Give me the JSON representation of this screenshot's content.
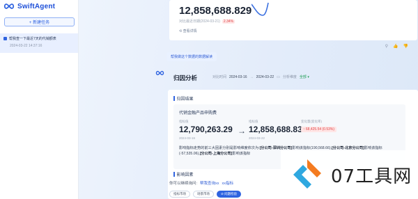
{
  "app": {
    "name": "SwiftAgent"
  },
  "sidebar": {
    "new_task_label": "+ 新建任务",
    "history": [
      {
        "title": "帮我查一下最近7天的代销额表",
        "date": "2024-03-22 14:37:16"
      }
    ]
  },
  "card1": {
    "value": "12,858,688.829",
    "sub": "对比最近日期(2024-03-21)",
    "change": "2.34%",
    "link": "查看详情"
  },
  "actions": {
    "pin": "⚲",
    "thumb_up": "👍",
    "thumb_down": "👎"
  },
  "suggest_pill": "帮我做这个数据的数据解读",
  "analysis": {
    "title": "归因分析",
    "time_label": "对比时间",
    "start_date": "2024-03-16",
    "end_date": "2024-03-22",
    "dim_label": "分析维度",
    "dim_value": "全部",
    "section_result": "归因结果",
    "product": "代销金融产品申购费",
    "from_label": "指标值",
    "to_label": "指标值",
    "from_value": "12,790,263.29",
    "to_value": "12,858,688.83",
    "from_date": "2024-03-16",
    "to_date": "2024-03-22",
    "change_label": "变化量(变化率)",
    "change_value": "↑ 68,425.54 (0.53%)",
    "desc_pre": "影响指标走势的前三大因素分别是影响维度依次为:",
    "desc_s1": "[分公司-深圳分公司]",
    "desc_m1": "影响该指标(190,568.66),",
    "desc_s2": "[分公司-北京分公司]",
    "desc_m2": "影响该指标(-57,535.06),",
    "desc_s3": "[分公司-上海分公司]",
    "desc_m3": "影响该指标",
    "section_factors": "影响因素"
  },
  "footer": {
    "question": "你可以继续询问:",
    "q1": "帮我查询xx",
    "q2": "xx指标"
  },
  "chips": [
    "指标市场",
    "场景市场",
    "⊘ 问题检验"
  ],
  "watermark": {
    "text": "07工具网"
  },
  "colors": {
    "brand": "#2f63e0",
    "danger": "#e0484a"
  }
}
